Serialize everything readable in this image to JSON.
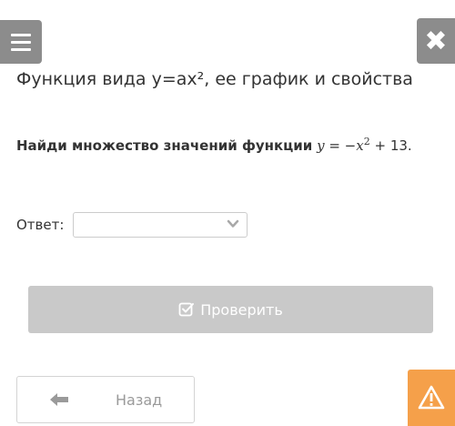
{
  "header": {
    "title": "Функция вида y=ax², ее график и свойства",
    "menu_icon": "hamburger-icon",
    "close_icon": "close-icon",
    "close_glyph": "✖"
  },
  "question": {
    "prompt": "Найди множество значений функции",
    "math_y": "y",
    "math_eq": " = −",
    "math_x": "x",
    "math_power": "2",
    "math_tail": " + 13."
  },
  "answer": {
    "label": "Ответ:",
    "selected_value": ""
  },
  "check_button": {
    "label": "Проверить",
    "icon": "checkbox-icon"
  },
  "back_button": {
    "label": "Назад",
    "icon": "arrow-left-icon"
  },
  "warning_button": {
    "icon": "warning-icon"
  },
  "colors": {
    "gray_button": "#8c8c8c",
    "disabled_button": "#c9c9c9",
    "warning": "#f5a04a",
    "text": "#333333"
  }
}
